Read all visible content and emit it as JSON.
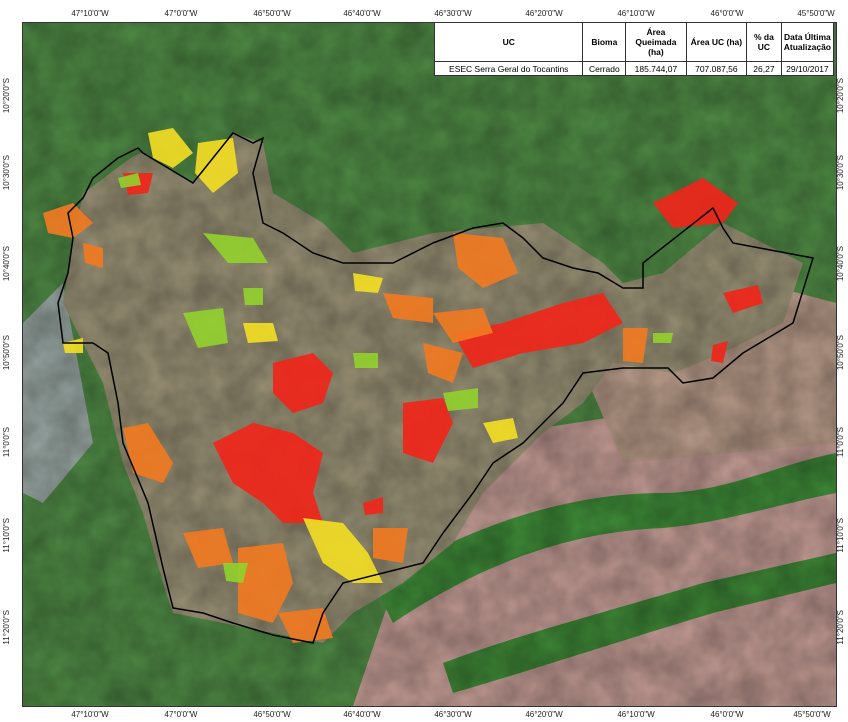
{
  "map": {
    "colors": {
      "burn_red": "#f01e14",
      "burn_orange": "#f0781e",
      "burn_yellow": "#f0dc1e",
      "burn_lightgreen": "#8fd22a",
      "background_savanna": "#8c8a6e",
      "background_forest": "#3f7f3c",
      "background_pink": "#c9a09a",
      "boundary": "#000000"
    }
  },
  "axes": {
    "top_ticks": [
      "47°10'0\"W",
      "47°0'0\"W",
      "46°50'0\"W",
      "46°40'0\"W",
      "46°30'0\"W",
      "46°20'0\"W",
      "46°10'0\"W",
      "46°0'0\"W",
      "45°50'0\"W"
    ],
    "bottom_ticks": [
      "47°10'0\"W",
      "47°0'0\"W",
      "46°50'0\"W",
      "46°40'0\"W",
      "46°30'0\"W",
      "46°20'0\"W",
      "46°10'0\"W",
      "46°0'0\"W",
      "45°50'0\"W"
    ],
    "left_ticks": [
      "10°20'0\"S",
      "10°30'0\"S",
      "10°40'0\"S",
      "10°50'0\"S",
      "11°0'0\"S",
      "11°10'0\"S",
      "11°20'0\"S"
    ],
    "right_ticks": [
      "10°20'0\"S",
      "10°30'0\"S",
      "10°40'0\"S",
      "10°50'0\"S",
      "11°0'0\"S",
      "11°10'0\"S",
      "11°20'0\"S"
    ]
  },
  "table": {
    "headers": [
      "UC",
      "Bioma",
      "Área Queimada (ha)",
      "Área UC (ha)",
      "% da UC",
      "Data Última Atualização"
    ],
    "row": [
      "ESEC Serra Geral do Tocantins",
      "Cerrado",
      "185.744,07",
      "707.087,56",
      "26,27",
      "29/10/2017"
    ]
  }
}
